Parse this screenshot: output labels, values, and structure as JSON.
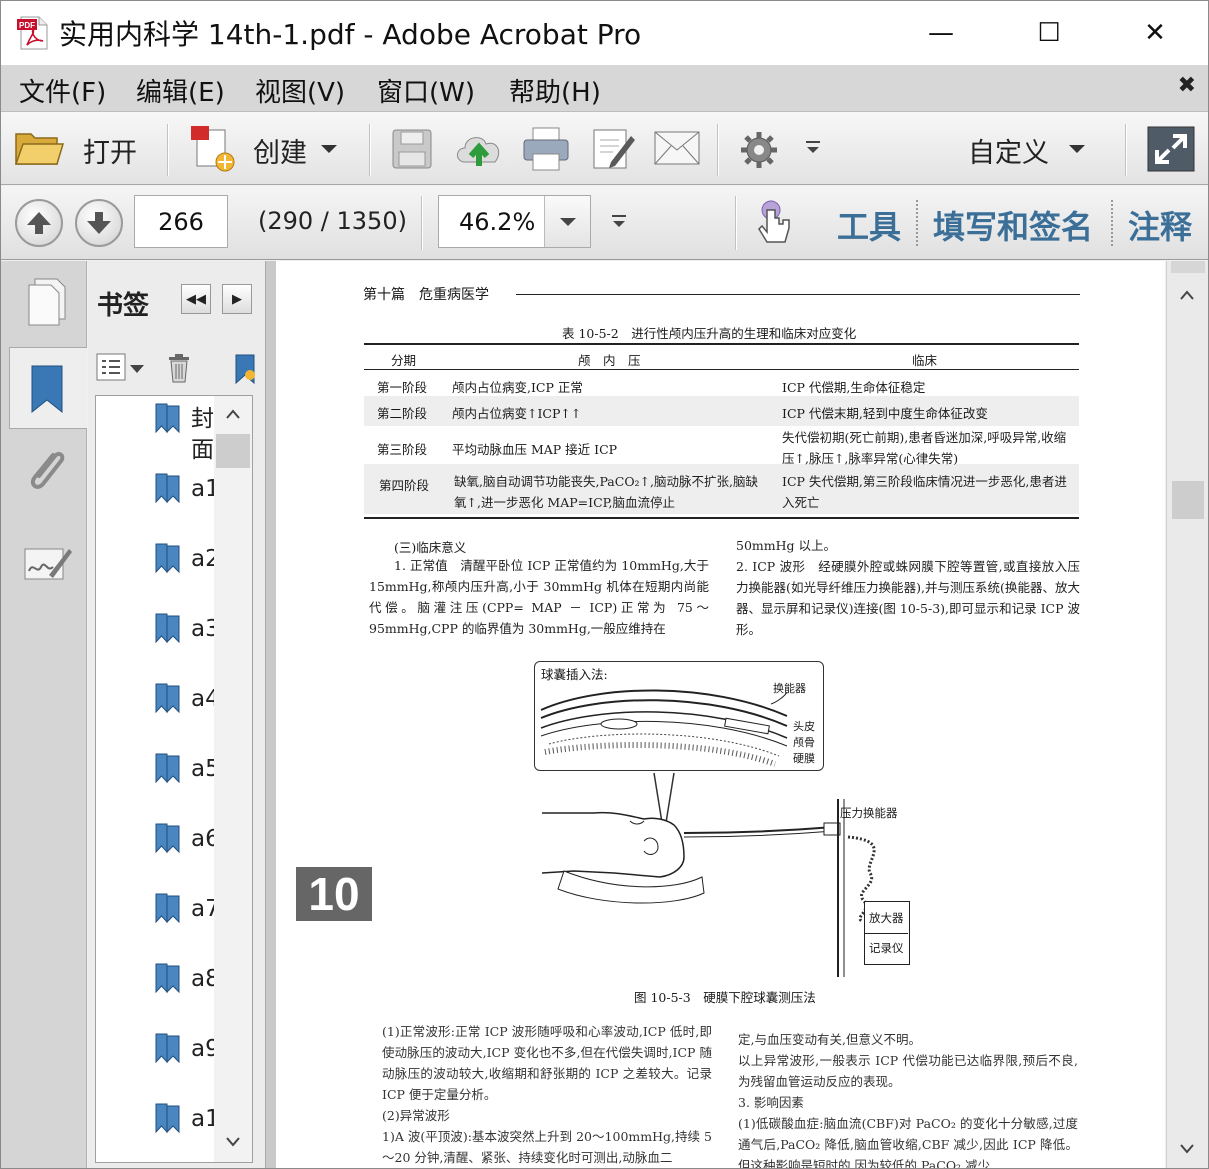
{
  "window": {
    "title": "实用内科学 14th-1.pdf - Adobe Acrobat Pro",
    "minimize": "—",
    "maximize": "☐",
    "close": "✕"
  },
  "menu": {
    "items": [
      "文件(F)",
      "编辑(E)",
      "视图(V)",
      "窗口(W)",
      "帮助(H)"
    ],
    "close_doc": "✖"
  },
  "toolbar": {
    "open_label": "打开",
    "create_label": "创建",
    "customize_label": "自定义"
  },
  "nav": {
    "page": "266",
    "page_count": "(290 / 1350)",
    "zoom": "46.2%",
    "tools": "工具",
    "fill_sign": "填写和签名",
    "comment": "注释"
  },
  "bookmarks": {
    "title": "书签",
    "items": [
      {
        "label": "封面"
      },
      {
        "label": "a1"
      },
      {
        "label": "a2"
      },
      {
        "label": "a3"
      },
      {
        "label": "a4"
      },
      {
        "label": "a5"
      },
      {
        "label": "a6"
      },
      {
        "label": "a7"
      },
      {
        "label": "a8"
      },
      {
        "label": "a9"
      },
      {
        "label": "a1"
      }
    ]
  },
  "page": {
    "header": "第十篇　危重病医学",
    "table_title": "表 10-5-2　进行性颅内压升高的生理和临床对应变化",
    "table_headers": [
      "分期",
      "颅　内　压",
      "临床"
    ],
    "table_rows": [
      {
        "stage": "第一阶段",
        "icp": "颅内占位病变,ICP 正常",
        "clinical": "ICP 代偿期,生命体征稳定"
      },
      {
        "stage": "第二阶段",
        "icp": "颅内占位病变↑ICP↑↑",
        "clinical": "ICP 代偿末期,轻到中度生命体征改变"
      },
      {
        "stage": "第三阶段",
        "icp": "平均动脉血压 MAP 接近 ICP",
        "clinical": "失代偿初期(死亡前期),患者昏迷加深,呼吸异常,收缩压↑,脉压↑,脉率异常(心律失常)"
      },
      {
        "stage": "第四阶段",
        "icp": "缺氧,脑自动调节功能丧失,PaCO₂↑,脑动脉不扩张,脑缺氧↑,进一步恶化 MAP=ICP,脑血流停止",
        "clinical": "ICP 失代偿期,第三阶段临床情况进一步恶化,患者进入死亡"
      }
    ],
    "section_title": "(三)临床意义",
    "para_left": "1. 正常值　清醒平卧位 ICP 正常值约为 10mmHg,大于 15mmHg,称颅内压升高,小于 30mmHg 机体在短期内尚能代偿。脑灌注压(CPP= MAP － ICP)正常为 75～95mmHg,CPP 的临界值为 30mmHg,一般应维持在",
    "para_right": "50mmHg 以上。\n2. ICP 波形　经硬膜外腔或蛛网膜下腔等置管,或直接放入压力换能器(如光导纤维压力换能器),并与测压系统(换能器、放大器、显示屏和记录仪)连接(图 10-5-3),即可显示和记录 ICP 波形。",
    "figure": {
      "inset_title": "球囊插入法:",
      "label_transducer": "换能器",
      "label_scalp": "头皮",
      "label_skull": "颅骨",
      "label_dura": "硬膜",
      "label_pressure": "压力换能器",
      "label_amp": "放大器",
      "label_recorder": "记录仪",
      "caption": "图 10-5-3　硬膜下腔球囊测压法"
    },
    "chapter_tab": "10",
    "bottom_left": "(1)正常波形:正常 ICP 波形随呼吸和心率波动,ICP 低时,即使动脉压的波动大,ICP 变化也不多,但在代偿失调时,ICP 随动脉压的波动较大,收缩期和舒张期的 ICP 之差较大。记录 ICP 便于定量分析。\n(2)异常波形\n1)A 波(平顶波):基本波突然上升到 20～100mmHg,持续 5～20 分钟,清醒、紧张、持续变化时可测出,动脉血二",
    "bottom_right": "定,与血压变动有关,但意义不明。\n以上异常波形,一般表示 ICP 代偿功能已达临界限,预后不良,为残留血管运动反应的表现。\n3. 影响因素\n(1)低碳酸血症:脑血流(CBF)对 PaCO₂ 的变化十分敏感,过度通气后,PaCO₂ 降低,脑血管收缩,CBF 减少,因此 ICP 降低。但这种影响是短时的,因为较低的 PaCO₂ 减少"
  }
}
